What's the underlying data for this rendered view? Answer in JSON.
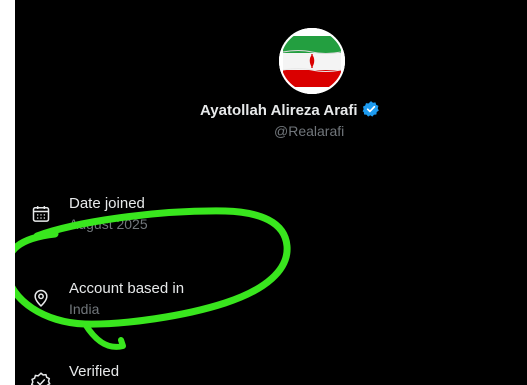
{
  "profile": {
    "display_name": "Ayatollah Alireza Arafi",
    "handle": "@Realarafi",
    "avatar_icon": "iran-flag-avatar",
    "verified_icon": "verified-badge-icon"
  },
  "about": {
    "items": [
      {
        "icon": "calendar-icon",
        "label": "Date joined",
        "value": "August 2025"
      },
      {
        "icon": "location-pin-icon",
        "label": "Account based in",
        "value": "India"
      },
      {
        "icon": "verified-check-icon",
        "label": "Verified",
        "value": ""
      }
    ]
  },
  "annotation": {
    "color": "#39e61e",
    "description_icon": "green-highlight-scribble"
  },
  "colors": {
    "background": "#000000",
    "primary_text": "#e7e9ea",
    "secondary_text": "#71767b",
    "verified_blue": "#1d9bf0"
  }
}
